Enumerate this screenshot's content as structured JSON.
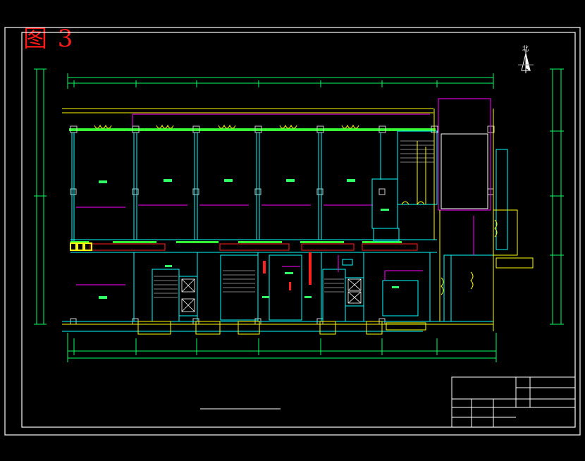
{
  "figure_label": "图 3",
  "north_label": "北",
  "colors": {
    "background": "#000000",
    "frame": "#ffffff",
    "dimension": "#00ff66",
    "wall": "#00ffff",
    "slab": "#33ff33",
    "accent": "#ff00ff",
    "column": "#aaaaaa",
    "door": "#ffff00",
    "pipe": "#ff2020",
    "label": "#ff0000"
  }
}
